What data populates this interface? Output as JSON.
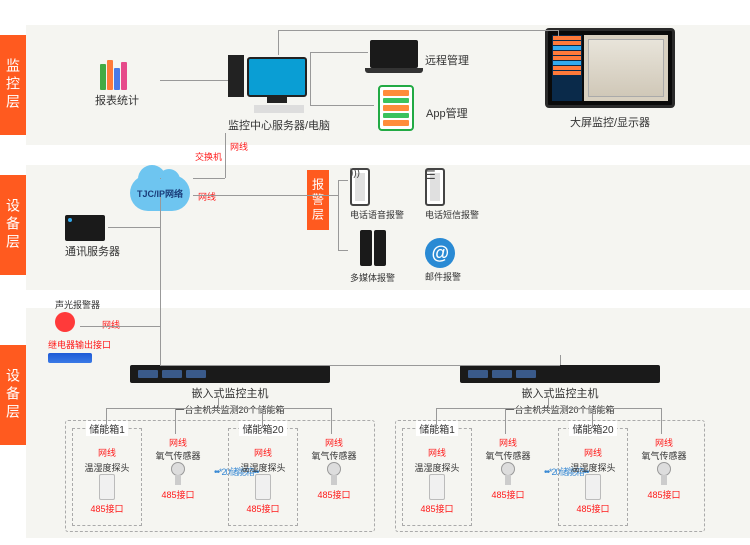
{
  "layers": {
    "monitor": "监控层",
    "device_upper": "设备层",
    "alarm": "报警层",
    "device_lower": "设备层"
  },
  "nodes": {
    "report_stats": "报表统计",
    "center_server": "监控中心服务器/电脑",
    "remote_mgmt": "远程管理",
    "app_mgmt": "App管理",
    "big_display": "大屏监控/显示器",
    "switch": "交换机",
    "tcpip": "TJC/IP网络",
    "comm_server": "通讯服务器",
    "voice_alarm": "电话语音报警",
    "sms_alarm": "电话短信报警",
    "media_alarm": "多媒体报警",
    "mail_alarm": "邮件报警",
    "beacon": "声光报警器",
    "relay_port": "继电器输出接口",
    "netcable": "网线",
    "embedded_host": "嵌入式监控主机",
    "host_note": "一台主机共监测20个储能箱",
    "between_note": "*20储能箱",
    "storage1": "储能箱1",
    "storage20": "储能箱20",
    "temp_sensor": "温湿度探头",
    "gas_sensor": "氧气传感器",
    "port485": "485接口"
  }
}
